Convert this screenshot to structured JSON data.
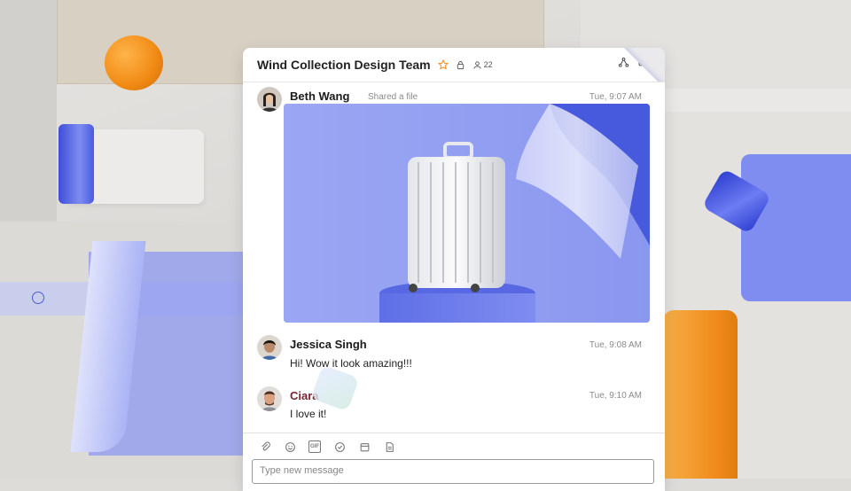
{
  "background": {
    "colors": {
      "accent_blue": "#8e98f0",
      "accent_orange": "#f08b1b"
    }
  },
  "chat": {
    "title": "Wind Collection Design Team",
    "member_count": "22",
    "header_icons": [
      "star-icon",
      "lock-icon",
      "members-icon",
      "share-icon",
      "video-icon"
    ],
    "messages": [
      {
        "author": "Beth Wang",
        "subtitle": "Shared a file",
        "time": "Tue, 9:07 AM",
        "text": ""
      },
      {
        "author": "Jessica Singh",
        "subtitle": "",
        "time": "Tue, 9:08 AM",
        "text": "Hi! Wow it look amazing!!!"
      },
      {
        "author": "Ciara",
        "subtitle": "",
        "time": "Tue, 9:10 AM",
        "text": "I love it!"
      }
    ],
    "composer": {
      "tools": [
        "attach-icon",
        "emoji-icon",
        "gif-icon",
        "task-icon",
        "calendar-icon",
        "note-icon"
      ],
      "gif_label": "GIF",
      "placeholder": "Type new message"
    }
  }
}
